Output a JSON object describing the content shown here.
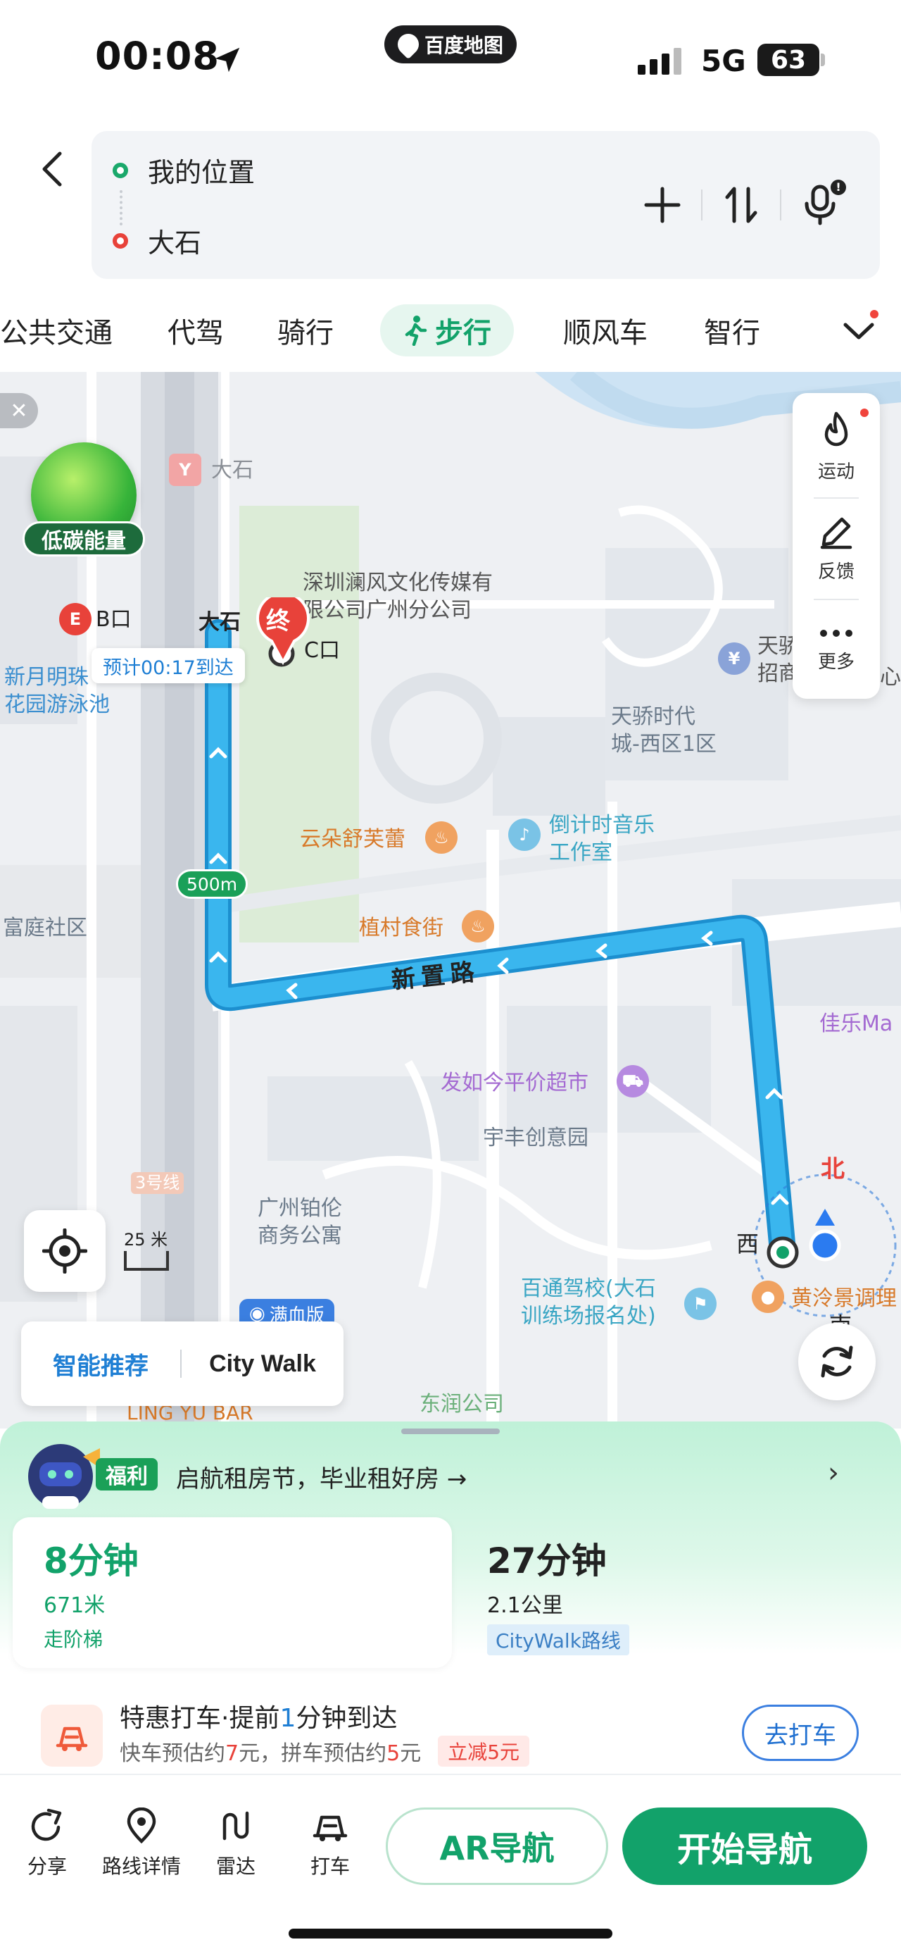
{
  "status_bar": {
    "time": "00:08",
    "app_name": "百度地图",
    "network": "5G",
    "battery": "63"
  },
  "route": {
    "from": "我的位置",
    "to": "大石",
    "icons": [
      "back-icon",
      "plus-icon",
      "swap-icon",
      "mic-icon"
    ],
    "mic_badge": "!"
  },
  "tabs": {
    "items": [
      "公共交通",
      "代驾",
      "骑行",
      "步行",
      "顺风车",
      "智行"
    ],
    "active": "步行"
  },
  "map": {
    "low_carbon": "低碳能量",
    "side_panel": {
      "sport": "运动",
      "feedback": "反馈",
      "more": "更多"
    },
    "end_marker": "终",
    "eta_tag": "预计00:17到达",
    "distance_tag": "500m",
    "scale": "25 米",
    "compass": {
      "north": "北",
      "west": "西",
      "south": "南"
    },
    "smart_recommend": "智能推荐",
    "city_walk": "City Walk",
    "full_version": "满血版",
    "labels": {
      "metro_dashi": "大石",
      "exit_b": "B口",
      "exit_c": "C口",
      "dashi_partial": "大石",
      "company": "深圳澜风文化传媒有\n限公司广州分公司",
      "swim": "新月明珠\n花园游泳池",
      "tianjiao": "天骄时代\n城-西区1区",
      "tianjiao_right": "天骄\n招商",
      "yunduo": "云朵舒芙蕾",
      "countdown": "倒计时音乐\n工作室",
      "futing": "富庭社区",
      "zhicun": "植村食街",
      "xinzhi_road": "新置路",
      "jiale": "佳乐Ma",
      "faru": "发如今平价超市",
      "yufeng": "宇丰创意园",
      "line3": "3号线",
      "bolun": "广州铂伦\n商务公寓",
      "baitong": "百通驾校(大石\n训练场报名处)",
      "huangling": "黄泠景调理",
      "dongrun": "东润公司",
      "lingyu": "LING YU BAR",
      "xin_right": "心"
    }
  },
  "sheet": {
    "promo_tag": "福利",
    "promo_text": "启航租房节，毕业租好房 →",
    "routes": [
      {
        "time": "8分钟",
        "distance": "671米",
        "note": "走阶梯"
      },
      {
        "time": "27分钟",
        "distance": "2.1公里",
        "note": "CityWalk路线"
      }
    ],
    "taxi": {
      "title_a": "特惠打车·提前",
      "title_num": "1",
      "title_b": "分钟到达",
      "sub_a": "快车预估约",
      "sub_a_num": "7",
      "sub_a_unit": "元，拼车预估约",
      "sub_b_num": "5",
      "sub_b_unit": "元",
      "discount": "立减5元",
      "button": "去打车"
    },
    "bottom_bar": {
      "share": "分享",
      "detail": "路线详情",
      "radar": "雷达",
      "taxi": "打车",
      "ar": "AR导航",
      "start": "开始导航"
    }
  },
  "colors": {
    "accent": "#12a26a",
    "route_blue": "#2aa9e6",
    "link_blue": "#1f7fd4",
    "warning_red": "#e8423a"
  }
}
